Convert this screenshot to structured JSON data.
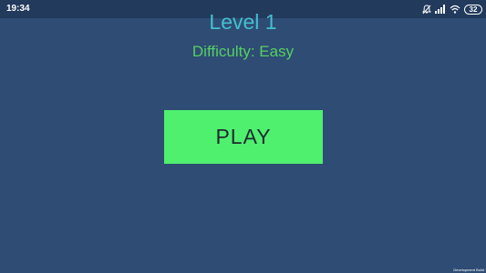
{
  "status_bar": {
    "time": "19:34",
    "battery": "32",
    "icons": [
      "notifications-off-icon",
      "signal-icon",
      "wifi-icon",
      "battery-icon"
    ]
  },
  "level": {
    "title": "Level 1",
    "difficulty": "Difficulty: Easy"
  },
  "play_button": {
    "label": "PLAY"
  },
  "watermark": {
    "text": "Development Build"
  },
  "colors": {
    "background": "#2e4c74",
    "status_bar": "#223a5c",
    "title": "#44bfcf",
    "difficulty": "#56cf63",
    "play_button": "#4ff06e",
    "play_text": "#1f2a33"
  }
}
